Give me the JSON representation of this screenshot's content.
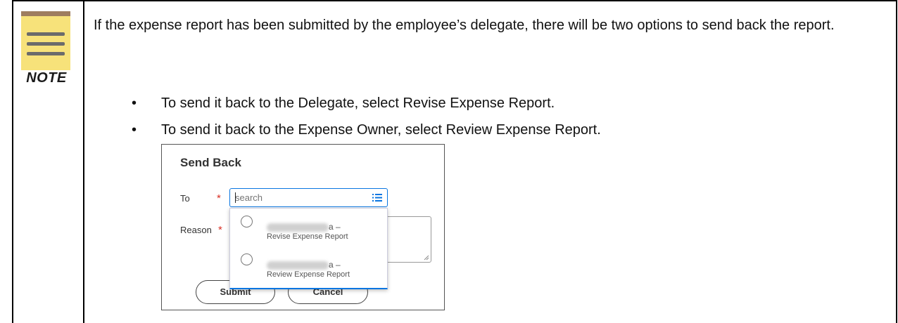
{
  "note": {
    "label": "NOTE",
    "icon": "note-icon",
    "colors": {
      "pad": "#f7e27a",
      "strip": "#9e7d5f",
      "lines": "#6b6b6b"
    }
  },
  "content": {
    "paragraph": "If the expense report has been submitted by the employee’s delegate, there will be two options to send back the report.",
    "bullets": [
      "To send it back to the Delegate, select Revise Expense Report.",
      "To send it back to the Expense Owner, select Review Expense Report."
    ]
  },
  "dialog": {
    "title": "Send Back",
    "to_label": "To",
    "reason_label": "Reason",
    "required_marker": "*",
    "search_placeholder": "search",
    "options": [
      {
        "tail": "a –",
        "subtitle": "Revise Expense Report"
      },
      {
        "tail": "a –",
        "subtitle": "Review Expense Report"
      }
    ],
    "submit_label": "Submit",
    "cancel_label": "Cancel",
    "accent_color": "#0875e1",
    "required_color": "#d93025"
  }
}
